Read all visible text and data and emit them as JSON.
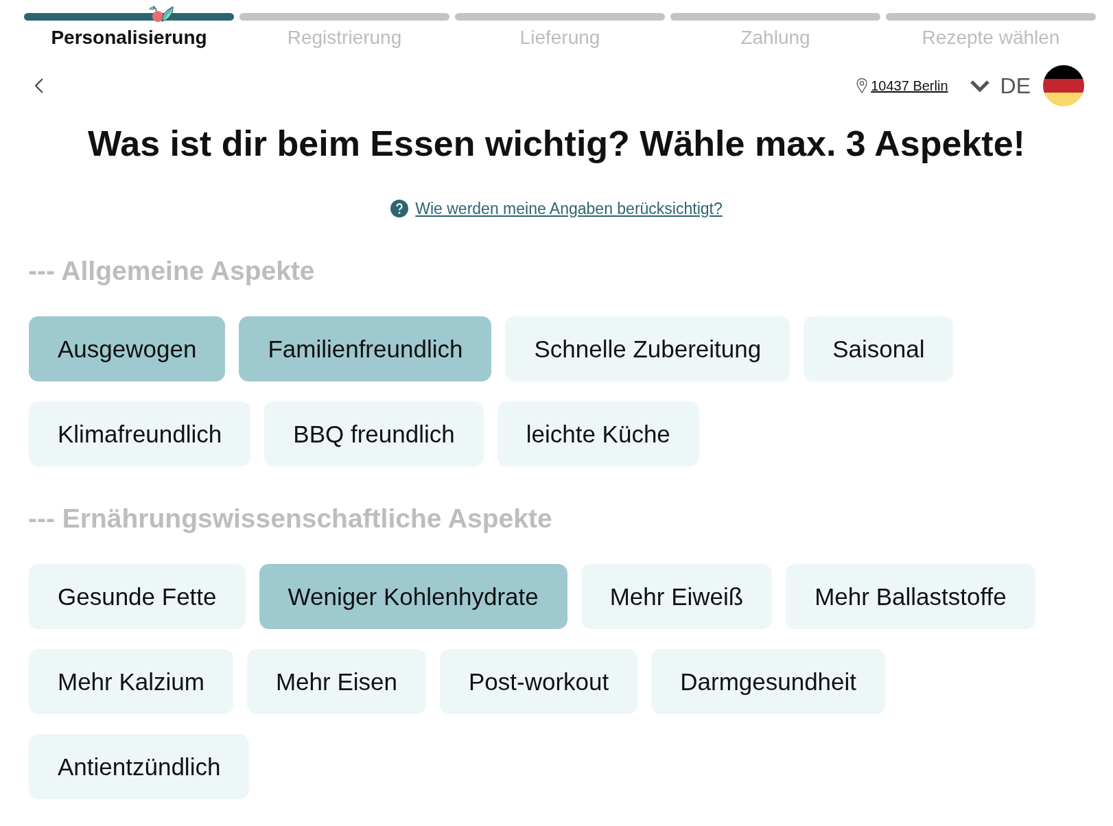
{
  "progress_steps": [
    {
      "label": "Personalisierung",
      "selected": true
    },
    {
      "label": "Registrierung",
      "selected": false
    },
    {
      "label": "Lieferung",
      "selected": false
    },
    {
      "label": "Zahlung",
      "selected": false
    },
    {
      "label": "Rezepte wählen",
      "selected": false
    }
  ],
  "header": {
    "location": "10437 Berlin",
    "language": "DE"
  },
  "title": "Was ist dir beim Essen wichtig? Wähle max. 3 Aspekte!",
  "help_link": "Wie werden meine Angaben berücksichtigt?",
  "sections": [
    {
      "heading": "--- Allgemeine Aspekte",
      "options": [
        {
          "label": "Ausgewogen",
          "selected": true
        },
        {
          "label": "Familienfreundlich",
          "selected": true
        },
        {
          "label": "Schnelle Zubereitung",
          "selected": false
        },
        {
          "label": "Saisonal",
          "selected": false
        },
        {
          "label": "Klimafreundlich",
          "selected": false
        },
        {
          "label": "BBQ freundlich",
          "selected": false
        },
        {
          "label": "leichte Küche",
          "selected": false
        }
      ]
    },
    {
      "heading": "--- Ernährungswissenschaftliche Aspekte",
      "options": [
        {
          "label": "Gesunde Fette",
          "selected": false
        },
        {
          "label": "Weniger Kohlenhydrate",
          "selected": true
        },
        {
          "label": "Mehr Eiweiß",
          "selected": false
        },
        {
          "label": "Mehr Ballaststoffe",
          "selected": false
        },
        {
          "label": "Mehr Kalzium",
          "selected": false
        },
        {
          "label": "Mehr Eisen",
          "selected": false
        },
        {
          "label": "Post-workout",
          "selected": false
        },
        {
          "label": "Darmgesundheit",
          "selected": false
        },
        {
          "label": "Antientzündlich",
          "selected": false
        }
      ]
    }
  ]
}
